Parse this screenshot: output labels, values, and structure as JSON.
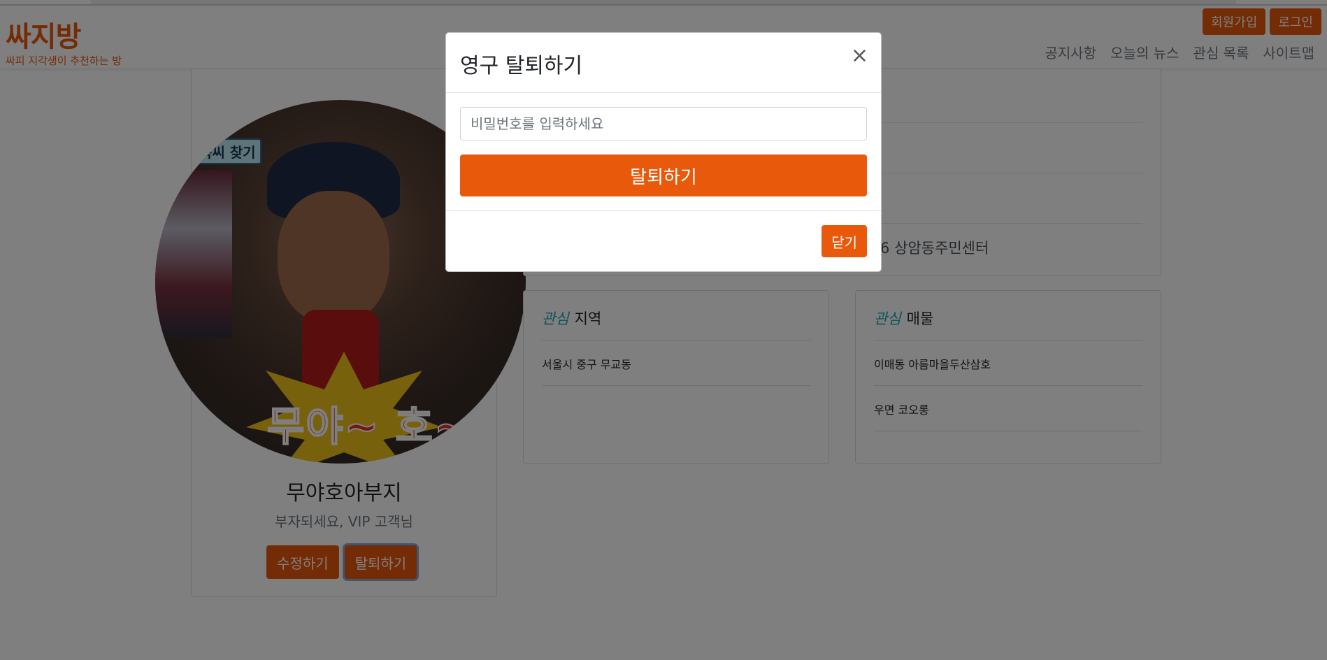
{
  "header": {
    "logo": "싸지방",
    "tagline": "싸피 지각생이 추천하는 방",
    "signup_label": "회원가입",
    "login_label": "로그인",
    "nav": [
      "공지사항",
      "오늘의 뉴스",
      "관심 목록",
      "사이트맵"
    ]
  },
  "profile": {
    "avatar_sticker": "목씨 찾기",
    "avatar_caption": "무야~ 호~",
    "name": "무야호아부지",
    "subtitle": "부자되세요, VIP 고객님",
    "edit_label": "수정하기",
    "withdraw_label": "탈퇴하기"
  },
  "info": {
    "address_fragment": "6 상암동주민센터"
  },
  "interest_region": {
    "emphasis": "관심",
    "title": "지역",
    "items": [
      "서울시 중구 무교동"
    ]
  },
  "interest_property": {
    "emphasis": "관심",
    "title": "매물",
    "items": [
      "이매동 아름마을두산삼호",
      "우면 코오롱"
    ]
  },
  "modal": {
    "title": "영구 탈퇴하기",
    "close_symbol": "×",
    "password_placeholder": "비밀번호를 입력하세요",
    "withdraw_label": "탈퇴하기",
    "close_label": "닫기"
  },
  "colors": {
    "accent": "#e8590c",
    "emphasis": "#17a2b8"
  }
}
